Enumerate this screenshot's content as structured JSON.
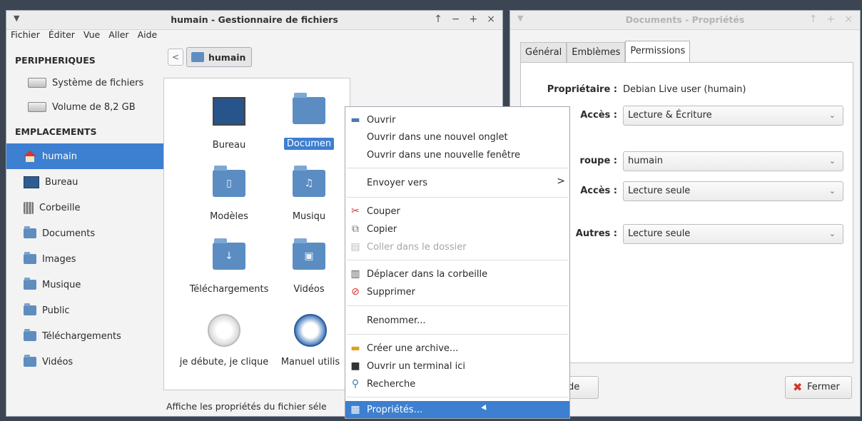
{
  "file_manager": {
    "title": "humain - Gestionnaire de fichiers",
    "title_buttons": [
      "↑",
      "−",
      "+",
      "×"
    ],
    "menu": [
      "Fichier",
      "Éditer",
      "Vue",
      "Aller",
      "Aide"
    ],
    "back_label": "<",
    "path_label": "humain",
    "sidebar": {
      "devices_header": "PERIPHERIQUES",
      "devices": [
        {
          "label": "Système de fichiers",
          "icon": "drive-icon"
        },
        {
          "label": "Volume de 8,2 GB",
          "icon": "drive-icon"
        }
      ],
      "places_header": "EMPLACEMENTS",
      "places": [
        {
          "label": "humain",
          "icon": "home-icon",
          "active": true
        },
        {
          "label": "Bureau",
          "icon": "desktop-icon"
        },
        {
          "label": "Corbeille",
          "icon": "trash-icon"
        },
        {
          "label": "Documents",
          "icon": "folder-icon"
        },
        {
          "label": "Images",
          "icon": "folder-icon"
        },
        {
          "label": "Musique",
          "icon": "folder-icon"
        },
        {
          "label": "Public",
          "icon": "folder-icon"
        },
        {
          "label": "Téléchargements",
          "icon": "folder-icon"
        },
        {
          "label": "Vidéos",
          "icon": "folder-icon"
        }
      ]
    },
    "items": [
      {
        "label": "Bureau",
        "icon": "desktop-icon"
      },
      {
        "label": "Documen",
        "icon": "folder-icon",
        "selected": true
      },
      {
        "label": "Modèles",
        "icon": "folder-icon"
      },
      {
        "label": "Musiqu",
        "icon": "music-folder-icon"
      },
      {
        "label": "Téléchargements",
        "icon": "download-folder-icon"
      },
      {
        "label": "Vidéos",
        "icon": "video-folder-icon"
      },
      {
        "label": "je débute, je clique",
        "icon": "debian-icon"
      },
      {
        "label": "Manuel utilis",
        "icon": "debian-manual-icon"
      }
    ],
    "status": "Affiche les propriétés du fichier séle"
  },
  "context_menu": {
    "items": [
      {
        "label": "Ouvrir",
        "icon": "open-icon"
      },
      {
        "label": "Ouvrir dans une nouvel onglet"
      },
      {
        "label": "Ouvrir dans une nouvelle fenêtre"
      },
      {
        "label": "Envoyer vers",
        "submenu_arrow": ">"
      },
      {
        "label": "Couper",
        "icon": "scissors-icon"
      },
      {
        "label": "Copier",
        "icon": "copy-icon"
      },
      {
        "label": "Coller dans le dossier",
        "icon": "paste-icon",
        "disabled": true
      },
      {
        "label": "Déplacer dans la corbeille",
        "icon": "trash-icon"
      },
      {
        "label": "Supprimer",
        "icon": "delete-icon"
      },
      {
        "label": "Renommer..."
      },
      {
        "label": "Créer une archive...",
        "icon": "archive-icon"
      },
      {
        "label": "Ouvrir un terminal ici",
        "icon": "terminal-icon"
      },
      {
        "label": "Recherche",
        "icon": "search-icon"
      },
      {
        "label": "Propriétés...",
        "icon": "properties-icon",
        "highlighted": true
      }
    ]
  },
  "properties": {
    "title": "Documents - Propriétés",
    "title_buttons": [
      "↑",
      "+",
      "×"
    ],
    "tabs": [
      {
        "label": "Général"
      },
      {
        "label": "Emblèmes"
      },
      {
        "label": "Permissions",
        "active": true
      }
    ],
    "owner_label": "Propriétaire :",
    "owner_value": "Debian Live user (humain)",
    "owner_access_label": "Accès :",
    "owner_access_value": "Lecture & Écriture",
    "group_label": "roupe :",
    "group_value": "humain",
    "group_access_label": "Accès :",
    "group_access_value": "Lecture seule",
    "others_label": "Autres :",
    "others_value": "Lecture seule",
    "help_button": "de",
    "close_button": "Fermer"
  },
  "colors": {
    "selection": "#3d7fd0",
    "close_icon": "#d2352a"
  }
}
